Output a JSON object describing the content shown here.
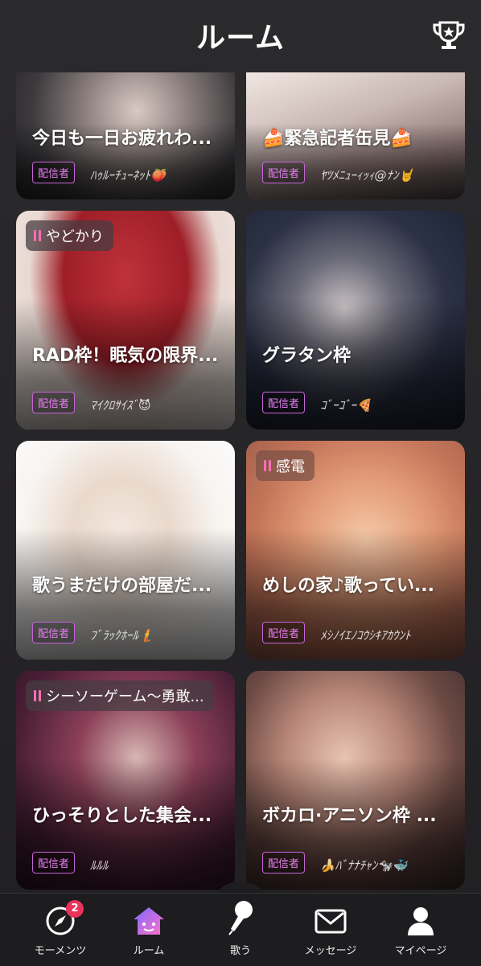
{
  "header": {
    "title": "ルーム"
  },
  "rooms": [
    {
      "title": "今日も一日お疲れわ...",
      "role": "配信者",
      "user": "ﾊｩﾙｰﾁｭｰﾈｯﾄ🍑",
      "tag": ""
    },
    {
      "title": "🍰緊急記者缶見🍰",
      "role": "配信者",
      "user": "ﾔﾂﾒﾆｭｰｨｯｨ@ﾅﾝ🤘",
      "tag": ""
    },
    {
      "title": "RAD枠！眠気の限界...",
      "role": "配信者",
      "user": "ﾏｲｸﾛｻｲｽﾞ😈",
      "tag": "やどかり"
    },
    {
      "title": "グラタン枠",
      "role": "配信者",
      "user": "ｺﾞｰｺﾞｰ🍕",
      "tag": ""
    },
    {
      "title": "歌うまだけの部屋だ...",
      "role": "配信者",
      "user": "ﾌﾞﾗｯｸﾎｰﾙ🧜",
      "tag": ""
    },
    {
      "title": "めしの家♪歌ってい...",
      "role": "配信者",
      "user": "ﾒｼﾉｲｴﾉｺｳｼｷｱｶｳﾝﾄ",
      "tag": "感電"
    },
    {
      "title": "ひっそりとした集会...",
      "role": "配信者",
      "user": "ﾙﾙﾙ",
      "tag": "シーソーゲーム〜勇敢..."
    },
    {
      "title": "ボカロ·アニソン枠 ...",
      "role": "配信者",
      "user": "🍌ﾊﾞﾅﾅﾁｬﾝ🐄🐳",
      "tag": ""
    }
  ],
  "tabbar": {
    "moments": {
      "label": "モーメンツ",
      "badge": "2"
    },
    "room": {
      "label": "ルーム"
    },
    "sing": {
      "label": "歌う"
    },
    "message": {
      "label": "メッセージ"
    },
    "mypage": {
      "label": "マイページ"
    }
  },
  "colors": {
    "accent": "#e57ef0",
    "badge": "#e8335a",
    "tag_bars": "#ff6fb4"
  }
}
